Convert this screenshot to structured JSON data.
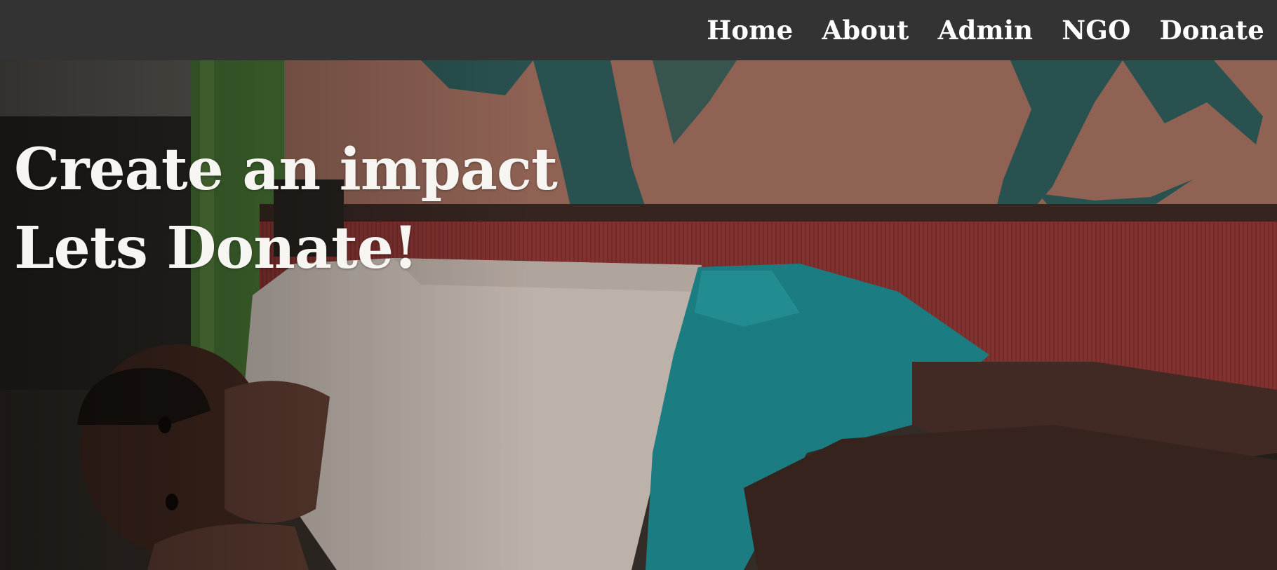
{
  "nav": {
    "links": [
      {
        "label": "Home"
      },
      {
        "label": "About"
      },
      {
        "label": "Admin"
      },
      {
        "label": "NGO"
      },
      {
        "label": "Donate"
      }
    ]
  },
  "hero": {
    "line1": "Create an impact",
    "line2": "Lets Donate!",
    "image": "photo-child-lying-on-bench"
  },
  "colors": {
    "navbar": "#333333",
    "nav_text": "#ffffff",
    "hero_text": "#f7f5f2"
  }
}
